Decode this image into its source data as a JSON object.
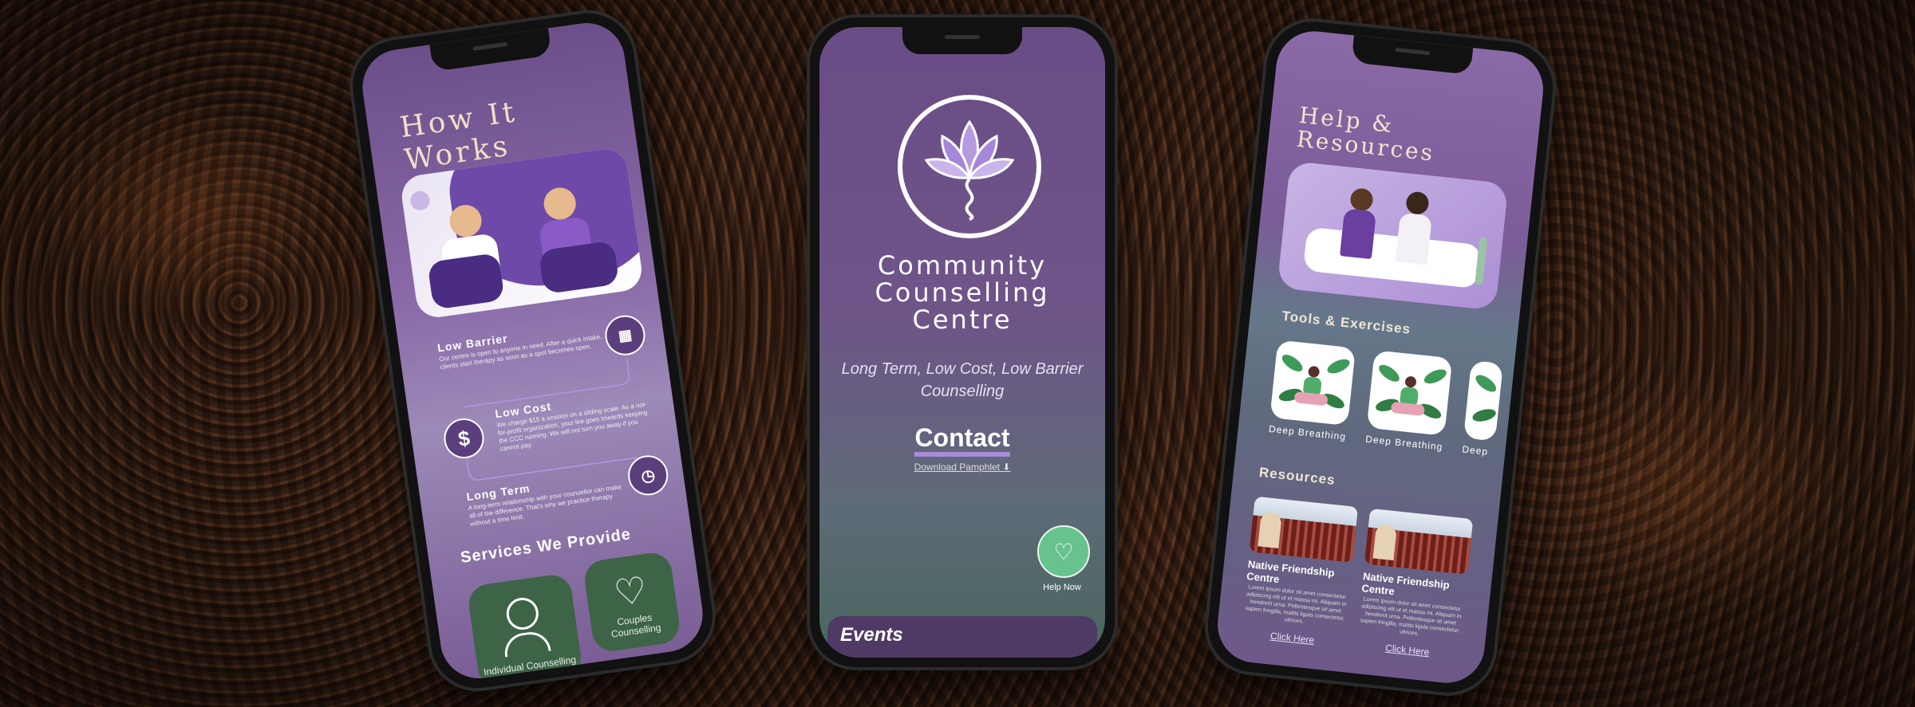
{
  "phone1": {
    "title": "How It Works",
    "features": [
      {
        "title": "Low Barrier",
        "text": "Our centre is open to anyone in need. After a quick intake, clients start therapy as soon as a spot becomes open."
      },
      {
        "title": "Low Cost",
        "text": "We charge $15 a session on a sliding scale. As a not-for-profit organization, your fee goes towards keeping the CCC running. We will not turn you away if you cannot pay."
      },
      {
        "title": "Long Term",
        "text": "A long-term relationship with your counsellor can make all of the difference. That's why we practice therapy without a time limit."
      }
    ],
    "services_title": "Services We Provide",
    "services": [
      {
        "label": "Individual Counselling",
        "icon": "person-icon"
      },
      {
        "label": "Couples Counselling",
        "icon": "heart-bandage-icon"
      }
    ]
  },
  "phone2": {
    "title_lines": [
      "Community",
      "Counselling",
      "Centre"
    ],
    "tagline": "Long Term, Low Cost, Low Barrier Counselling",
    "contact_label": "Contact",
    "download_label": "Download Pamphlet ⬇",
    "help_label": "Help Now",
    "events_label": "Events"
  },
  "phone3": {
    "title_lines": [
      "Help &",
      "Resources"
    ],
    "tools_title": "Tools & Exercises",
    "tools": [
      "Deep Breathing",
      "Deep Breathing",
      "Deep"
    ],
    "resources_title": "Resources",
    "resources": [
      {
        "title": "Native Friendship Centre",
        "desc": "Lorem ipsum dolor sit amet consectetur adipiscing elit ut et massa mi. Aliquam in hendrerit urna. Pellentesque sit amet sapien fringilla, mattis ligula consectetur, ultrices.",
        "link": "Click Here"
      },
      {
        "title": "Native Friendship Centre",
        "desc": "Lorem ipsum dolor sit amet consectetur adipiscing elit ut et massa mi. Aliquam in hendrerit urna. Pellentesque sit amet sapien fringilla, mattis ligula consectetur, ultrices.",
        "link": "Click Here"
      }
    ]
  },
  "colors": {
    "purple": "#6c4f8a",
    "green": "#3e6447",
    "help_green": "#67c28e",
    "cream": "#f3dfc5"
  }
}
